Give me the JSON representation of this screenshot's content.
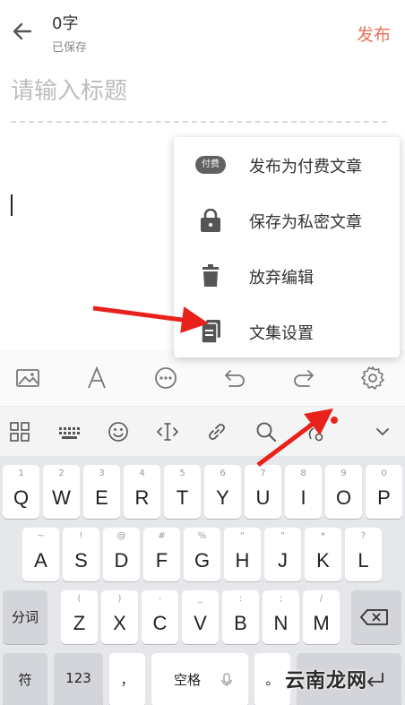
{
  "header": {
    "word_count": "0字",
    "save_status": "已保存",
    "publish_label": "发布"
  },
  "editor": {
    "title_placeholder": "请输入标题"
  },
  "menu": {
    "items": [
      {
        "label": "发布为付费文章",
        "icon": "paid-badge",
        "badge": "付费"
      },
      {
        "label": "保存为私密文章",
        "icon": "lock-icon"
      },
      {
        "label": "放弃编辑",
        "icon": "trash-icon"
      },
      {
        "label": "文集设置",
        "icon": "collection-icon"
      }
    ]
  },
  "toolbar": {
    "row1": [
      "image-icon",
      "font-icon",
      "more-icon",
      "undo-icon",
      "redo-icon",
      "settings-icon"
    ],
    "row2": [
      "grid-icon",
      "keyboard-icon",
      "emoji-icon",
      "cursor-icon",
      "link-icon",
      "search-icon",
      "voice-icon",
      "collapse-icon"
    ]
  },
  "keyboard": {
    "row1": [
      [
        "1",
        "Q"
      ],
      [
        "2",
        "W"
      ],
      [
        "3",
        "E"
      ],
      [
        "4",
        "R"
      ],
      [
        "5",
        "T"
      ],
      [
        "6",
        "Y"
      ],
      [
        "7",
        "U"
      ],
      [
        "8",
        "I"
      ],
      [
        "9",
        "O"
      ],
      [
        "0",
        "P"
      ]
    ],
    "row2": [
      [
        "~",
        "A"
      ],
      [
        "!",
        "S"
      ],
      [
        "@",
        "D"
      ],
      [
        "#",
        "F"
      ],
      [
        "%",
        "G"
      ],
      [
        "“",
        "H"
      ],
      [
        "”",
        "J"
      ],
      [
        "*",
        "K"
      ],
      [
        "?",
        "L"
      ]
    ],
    "row3": [
      [
        "(",
        "Z"
      ],
      [
        ")",
        "X"
      ],
      [
        "-",
        "C"
      ],
      [
        "_",
        "V"
      ],
      [
        ":",
        "B"
      ],
      [
        ";",
        "N"
      ],
      [
        "/",
        "M"
      ]
    ],
    "shift_label": "分词",
    "symbol_label": "符",
    "num_label": "123",
    "comma_label": "，",
    "space_label": "空格",
    "period_label": "。"
  },
  "colors": {
    "accent": "#e8735a",
    "arrow": "#e8221b"
  },
  "watermark": "云南龙网"
}
